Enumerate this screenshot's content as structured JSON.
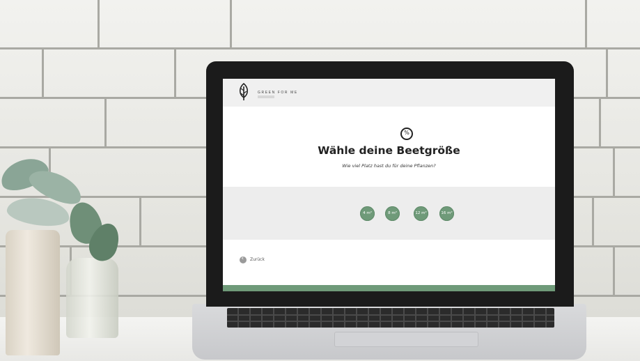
{
  "app": {
    "brand_name": "GREEN FOR ME"
  },
  "question": {
    "step_icon_glyph": "%",
    "title": "Wähle deine Beetgröße",
    "subtitle": "Wie viel Platz hast du für deine Pflanzen?"
  },
  "options": [
    {
      "label": "4 m²"
    },
    {
      "label": "8 m²"
    },
    {
      "label": "12 m²"
    },
    {
      "label": "16 m²"
    }
  ],
  "navigation": {
    "back_label": "Zurück"
  },
  "colors": {
    "accent": "#6f9a79",
    "background_band": "#ededed"
  },
  "icons": [
    "leaf-logo-icon",
    "percent-icon",
    "back-arrow-icon"
  ]
}
